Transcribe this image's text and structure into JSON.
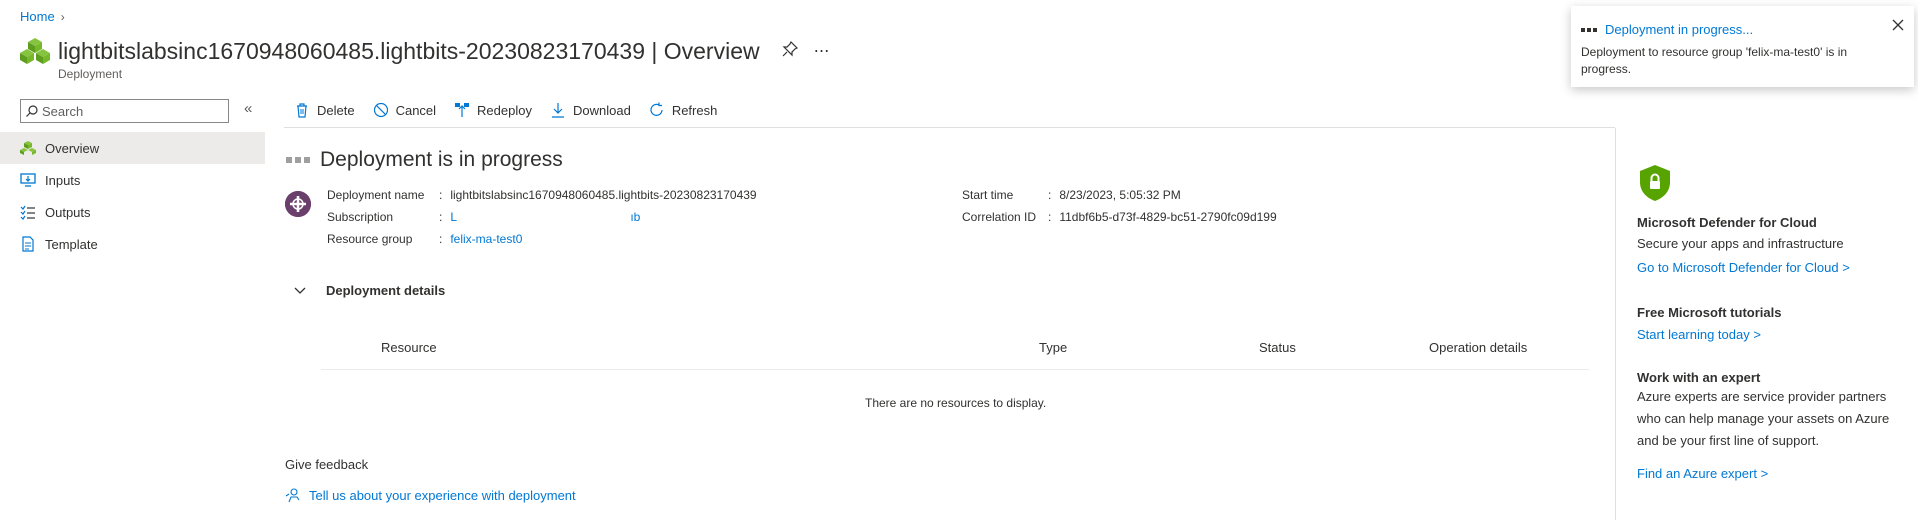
{
  "breadcrumb": {
    "home": "Home"
  },
  "header": {
    "title": "lightbitslabsinc1670948060485.lightbits-20230823170439 | Overview",
    "subtitle": "Deployment"
  },
  "sidebar": {
    "search_placeholder": "Search",
    "items": [
      {
        "label": "Overview",
        "icon": "overview-icon"
      },
      {
        "label": "Inputs",
        "icon": "inputs-icon"
      },
      {
        "label": "Outputs",
        "icon": "outputs-icon"
      },
      {
        "label": "Template",
        "icon": "template-icon"
      }
    ]
  },
  "toolbar": {
    "delete": "Delete",
    "cancel": "Cancel",
    "redeploy": "Redeploy",
    "download": "Download",
    "refresh": "Refresh"
  },
  "status": {
    "heading": "Deployment is in progress"
  },
  "info": {
    "deployment_name_label": "Deployment name",
    "deployment_name": "lightbitslabsinc1670948060485.lightbits-20230823170439",
    "subscription_label": "Subscription",
    "subscription_start": "L",
    "subscription_end": "ıb",
    "resource_group_label": "Resource group",
    "resource_group": "felix-ma-test0",
    "start_time_label": "Start time",
    "start_time": "8/23/2023, 5:05:32 PM",
    "correlation_label": "Correlation ID",
    "correlation_id": "11dbf6b5-d73f-4829-bc51-2790fc09d199",
    "colon": ":"
  },
  "details": {
    "title": "Deployment details",
    "columns": [
      "Resource",
      "Type",
      "Status",
      "Operation details"
    ],
    "empty": "There are no resources to display."
  },
  "feedback": {
    "title": "Give feedback",
    "link": "Tell us about your experience with deployment"
  },
  "right_panel": {
    "defender_title": "Microsoft Defender for Cloud",
    "defender_text": "Secure your apps and infrastructure",
    "defender_link": "Go to Microsoft Defender for Cloud >",
    "tutorials_title": "Free Microsoft tutorials",
    "tutorials_link": "Start learning today >",
    "expert_title": "Work with an expert",
    "expert_text": "Azure experts are service provider partners who can help manage your assets on Azure and be your first line of support.",
    "expert_link": "Find an Azure expert >"
  },
  "toast": {
    "title": "Deployment in progress...",
    "body": "Deployment to resource group 'felix-ma-test0' is in progress."
  },
  "colors": {
    "accent": "#0078d4",
    "active_nav": "#edebe9",
    "shield": "#57a300"
  }
}
